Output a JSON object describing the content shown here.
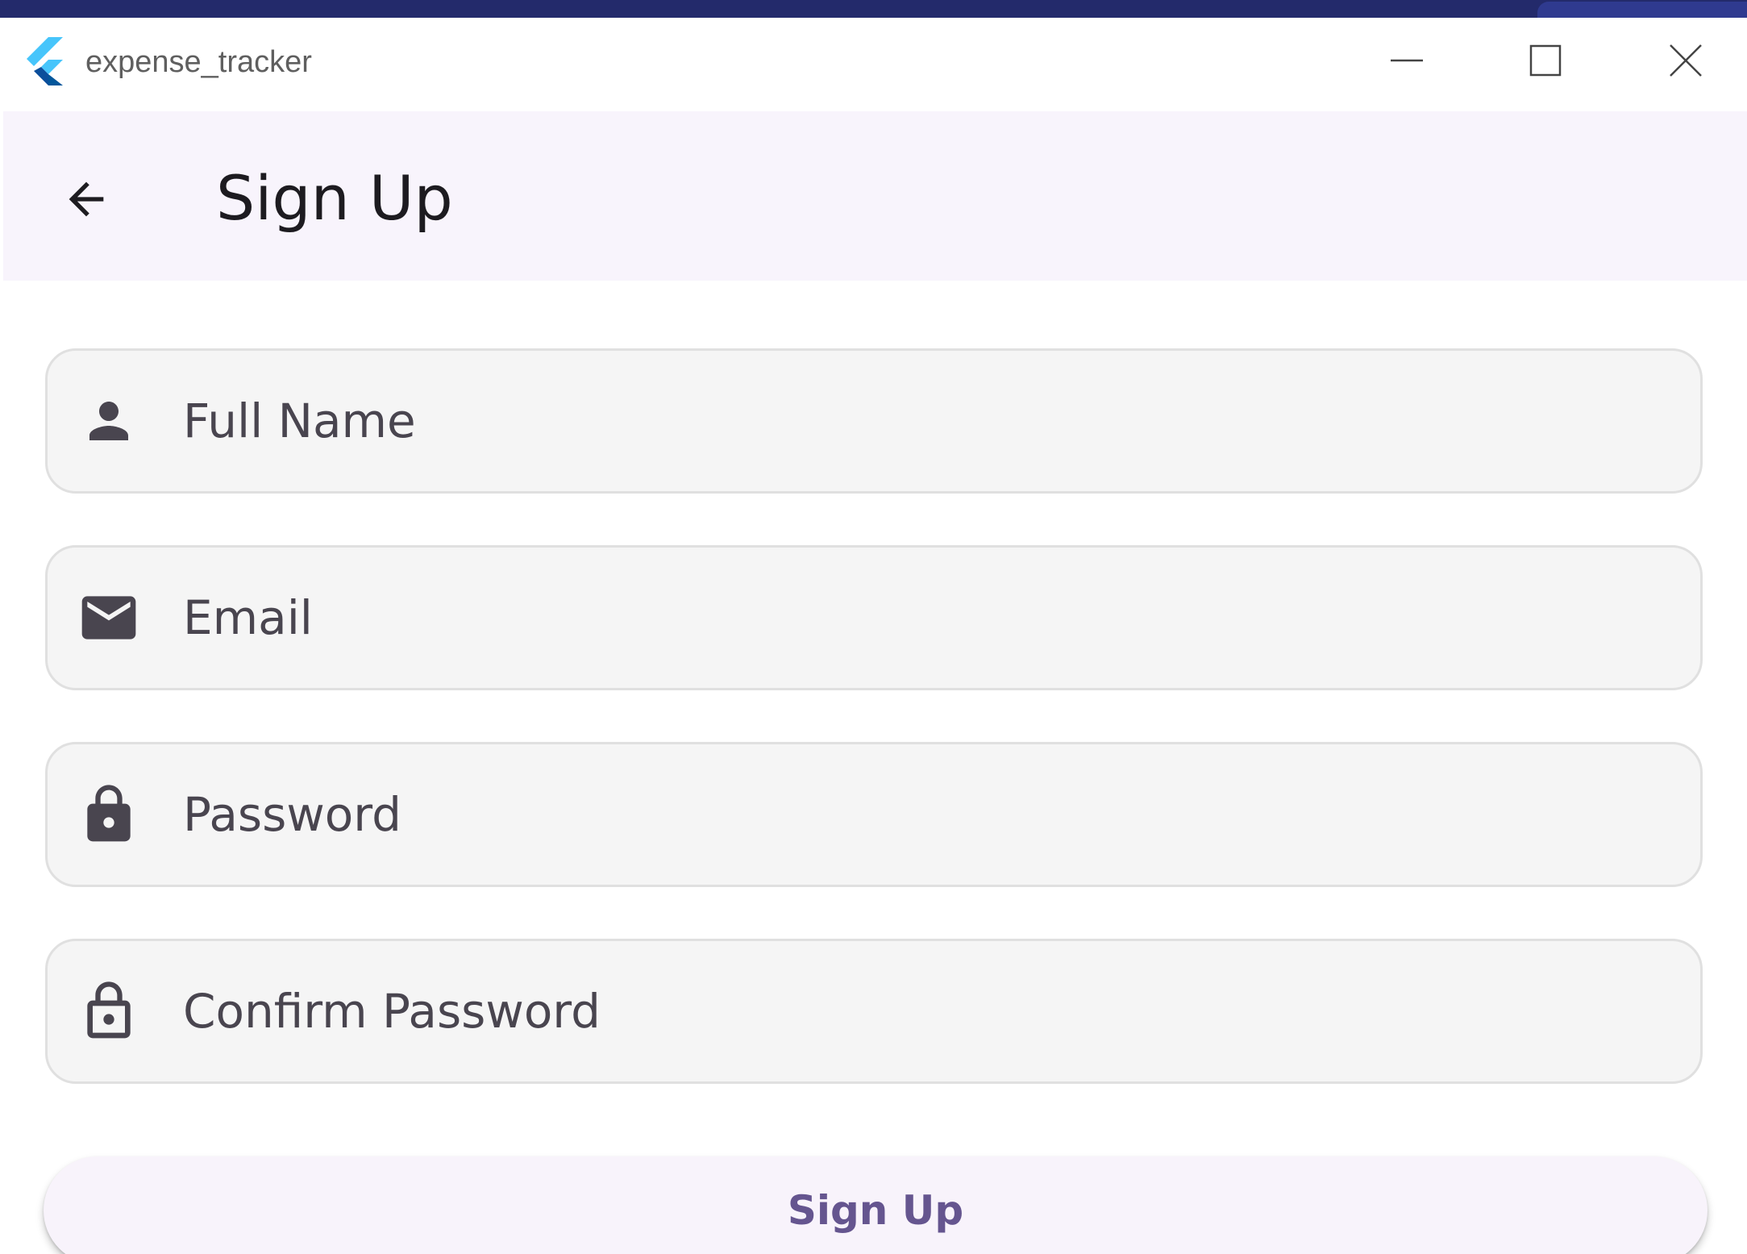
{
  "window": {
    "title": "expense_tracker",
    "controls": {
      "minimize": "minimize-icon",
      "maximize": "maximize-icon",
      "close": "close-icon"
    }
  },
  "appbar": {
    "title": "Sign Up",
    "back_icon": "arrow-back-icon"
  },
  "form": {
    "full_name": {
      "placeholder": "Full Name",
      "value": "",
      "icon": "person-icon"
    },
    "email": {
      "placeholder": "Email",
      "value": "",
      "icon": "mail-icon"
    },
    "password": {
      "placeholder": "Password",
      "value": "",
      "icon": "lock-icon"
    },
    "confirm_password": {
      "placeholder": "Confirm Password",
      "value": "",
      "icon": "lock-outline-icon"
    }
  },
  "actions": {
    "signup_label": "Sign Up"
  },
  "colors": {
    "appbar_bg": "#f8f4fc",
    "field_bg": "#f5f5f5",
    "button_text": "#65558f",
    "icon": "#49454f"
  }
}
